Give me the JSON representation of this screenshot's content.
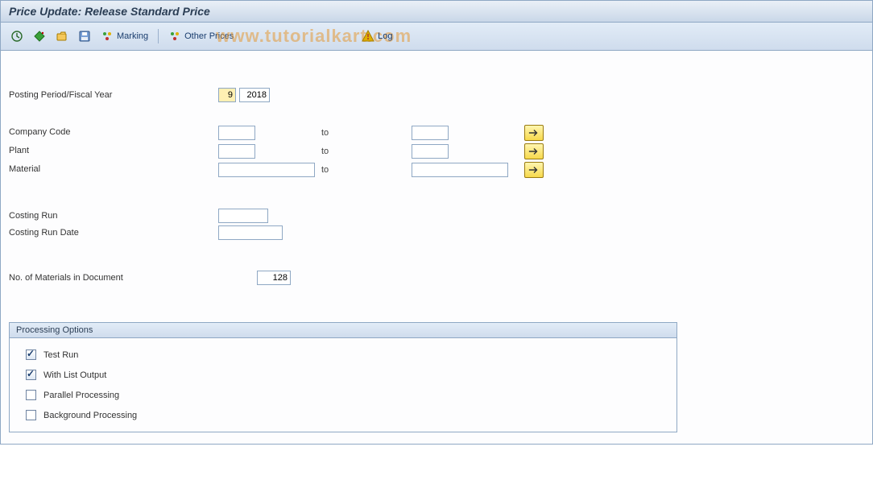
{
  "title": "Price Update: Release Standard Price",
  "watermark": "www.tutorialkart.com",
  "toolbar": {
    "marking_label": "Marking",
    "other_prices_label": "Other Prices",
    "log_label": "Log"
  },
  "fields": {
    "posting_period_label": "Posting Period/Fiscal Year",
    "posting_period_value": "9",
    "fiscal_year_value": "2018",
    "company_code_label": "Company Code",
    "company_code_from": "",
    "company_code_to": "",
    "plant_label": "Plant",
    "plant_from": "",
    "plant_to": "",
    "material_label": "Material",
    "material_from": "",
    "material_to": "",
    "to_label": "to",
    "costing_run_label": "Costing Run",
    "costing_run_value": "",
    "costing_run_date_label": "Costing Run Date",
    "costing_run_date_value": "",
    "no_materials_label": "No. of Materials in Document",
    "no_materials_value": "128"
  },
  "group": {
    "title": "Processing Options",
    "test_run_label": "Test Run",
    "test_run_checked": true,
    "with_list_label": "With List Output",
    "with_list_checked": true,
    "parallel_label": "Parallel Processing",
    "parallel_checked": false,
    "background_label": "Background Processing",
    "background_checked": false
  }
}
